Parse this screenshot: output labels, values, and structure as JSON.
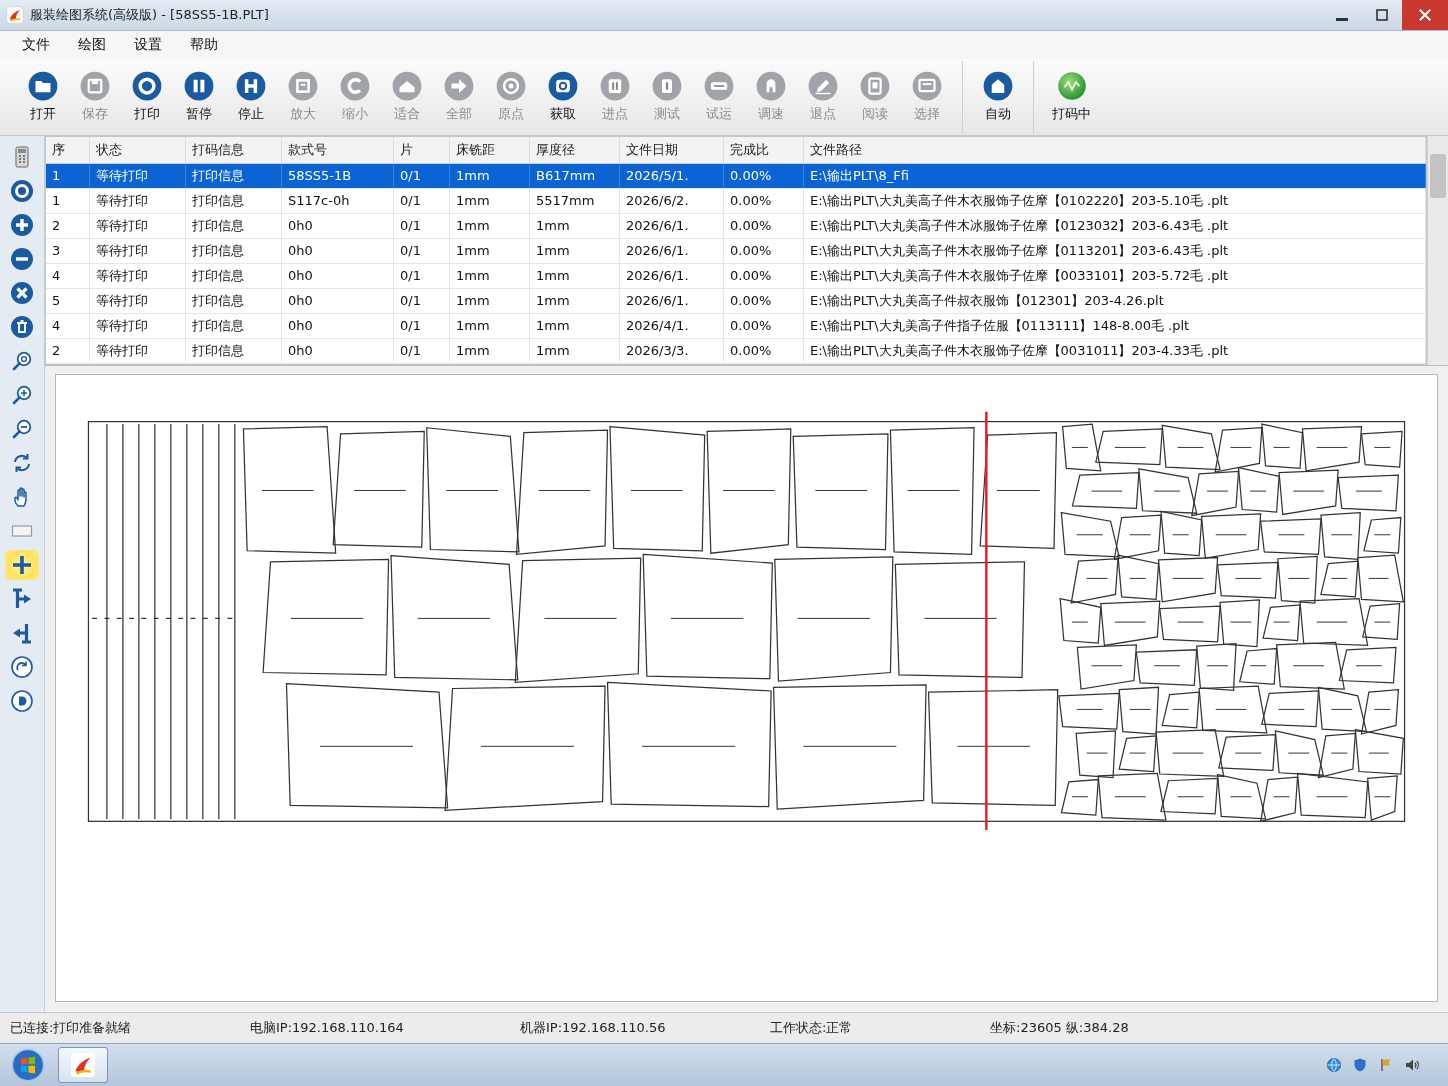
{
  "window": {
    "title": "服装绘图系统(高级版) - [58SS5-1B.PLT]"
  },
  "menu": [
    "文件",
    "绘图",
    "设置",
    "帮助"
  ],
  "toolbar": {
    "groups": [
      {
        "items": [
          {
            "kind": "button",
            "label": "打开",
            "disabled": false
          },
          {
            "kind": "button",
            "label": "保存",
            "disabled": true
          },
          {
            "kind": "button",
            "label": "打印",
            "disabled": false
          },
          {
            "kind": "button",
            "label": "暂停",
            "disabled": false
          },
          {
            "kind": "button",
            "label": "停止",
            "disabled": false
          },
          {
            "kind": "button",
            "label": "放大",
            "disabled": true
          },
          {
            "kind": "button",
            "label": "缩小",
            "disabled": true
          },
          {
            "kind": "button",
            "label": "适合",
            "disabled": true
          },
          {
            "kind": "button",
            "label": "全部",
            "disabled": true
          },
          {
            "kind": "button",
            "label": "原点",
            "disabled": true
          },
          {
            "kind": "button",
            "label": "获取",
            "disabled": false
          },
          {
            "kind": "button",
            "label": "进点",
            "disabled": true
          },
          {
            "kind": "button",
            "label": "测试",
            "disabled": true
          },
          {
            "kind": "button",
            "label": "试运",
            "disabled": true
          },
          {
            "kind": "button",
            "label": "调速",
            "disabled": true
          },
          {
            "kind": "button",
            "label": "退点",
            "disabled": true
          },
          {
            "kind": "button",
            "label": "阅读",
            "disabled": true
          },
          {
            "kind": "button",
            "label": "选择",
            "disabled": true
          }
        ]
      },
      {
        "items": [
          {
            "kind": "button",
            "label": "自动",
            "disabled": false
          }
        ]
      },
      {
        "items": [
          {
            "kind": "indicator",
            "label": "打码中"
          }
        ]
      }
    ]
  },
  "side_toolbar": {
    "tools": [
      {
        "selected": false
      },
      {
        "selected": false
      },
      {
        "selected": false
      },
      {
        "selected": false
      },
      {
        "selected": false
      },
      {
        "selected": false
      },
      {
        "selected": false
      },
      {
        "selected": false
      },
      {
        "selected": false
      },
      {
        "selected": false
      },
      {
        "selected": false
      },
      {
        "selected": false
      },
      {
        "selected": true
      },
      {
        "selected": false
      },
      {
        "selected": false
      },
      {
        "selected": false
      },
      {
        "selected": false
      }
    ]
  },
  "table": {
    "columns": [
      "序",
      "状态",
      "打码信息",
      "款式号",
      "片",
      "床铣距",
      "厚度径",
      "文件日期",
      "完成比",
      "文件路径"
    ],
    "rows": [
      {
        "selected": true,
        "cells": [
          "1",
          "等待打印",
          "打印信息",
          "58SS5-1B",
          "0/1",
          "1mm",
          "B617mm",
          "2026/5/1.",
          "0.00%",
          "E:\\输出PLT\\8_Ffi"
        ]
      },
      {
        "selected": false,
        "cells": [
          "1",
          "等待打印",
          "打印信息",
          "S117c-0h",
          "0/1",
          "1mm",
          "5517mm",
          "2026/6/2.",
          "0.00%",
          "E:\\输出PLT\\大丸美高子件木衣服饰子佐摩【0102220】203-5.10毛 .plt"
        ]
      },
      {
        "selected": false,
        "cells": [
          "2",
          "等待打印",
          "打印信息",
          "0h0",
          "0/1",
          "1mm",
          "1mm",
          "2026/6/1.",
          "0.00%",
          "E:\\输出PLT\\大丸美高子件木冰服饰子佐摩【0123032】203-6.43毛 .plt"
        ]
      },
      {
        "selected": false,
        "cells": [
          "3",
          "等待打印",
          "打印信息",
          "0h0",
          "0/1",
          "1mm",
          "1mm",
          "2026/6/1.",
          "0.00%",
          "E:\\输出PLT\\大丸美高子件木衣服饰子佐摩【0113201】203-6.43毛 .plt"
        ]
      },
      {
        "selected": false,
        "cells": [
          "4",
          "等待打印",
          "打印信息",
          "0h0",
          "0/1",
          "1mm",
          "1mm",
          "2026/6/1.",
          "0.00%",
          "E:\\输出PLT\\大丸美高子件木衣服饰子佐摩【0033101】203-5.72毛 .plt"
        ]
      },
      {
        "selected": false,
        "cells": [
          "5",
          "等待打印",
          "打印信息",
          "0h0",
          "0/1",
          "1mm",
          "1mm",
          "2026/6/1.",
          "0.00%",
          "E:\\输出PLT\\大丸美高子件叔衣服饰【012301】203-4.26.plt"
        ]
      },
      {
        "selected": false,
        "cells": [
          "4",
          "等待打印",
          "打印信息",
          "0h0",
          "0/1",
          "1mm",
          "1mm",
          "2026/4/1.",
          "0.00%",
          "E:\\输出PLT\\大丸美高子件指子佐服【0113111】148-8.00毛 .plt"
        ]
      },
      {
        "selected": false,
        "cells": [
          "2",
          "等待打印",
          "打印信息",
          "0h0",
          "0/1",
          "1mm",
          "1mm",
          "2026/3/3.",
          "0.00%",
          "E:\\输出PLT\\大丸美高子件木衣服饰子佐摩【0031011】203-4.33毛 .plt"
        ]
      }
    ]
  },
  "status_bar": {
    "connection": "已连接:打印准备就绪",
    "computer_ip": "电脑IP:192.168.110.164",
    "machine_ip": "机器IP:192.168.110.56",
    "work_state": "工作状态:正常",
    "coordinates": "坐标:23605 纵:384.28"
  },
  "taskbar": {
    "apps": [
      {
        "selected": true
      }
    ]
  }
}
